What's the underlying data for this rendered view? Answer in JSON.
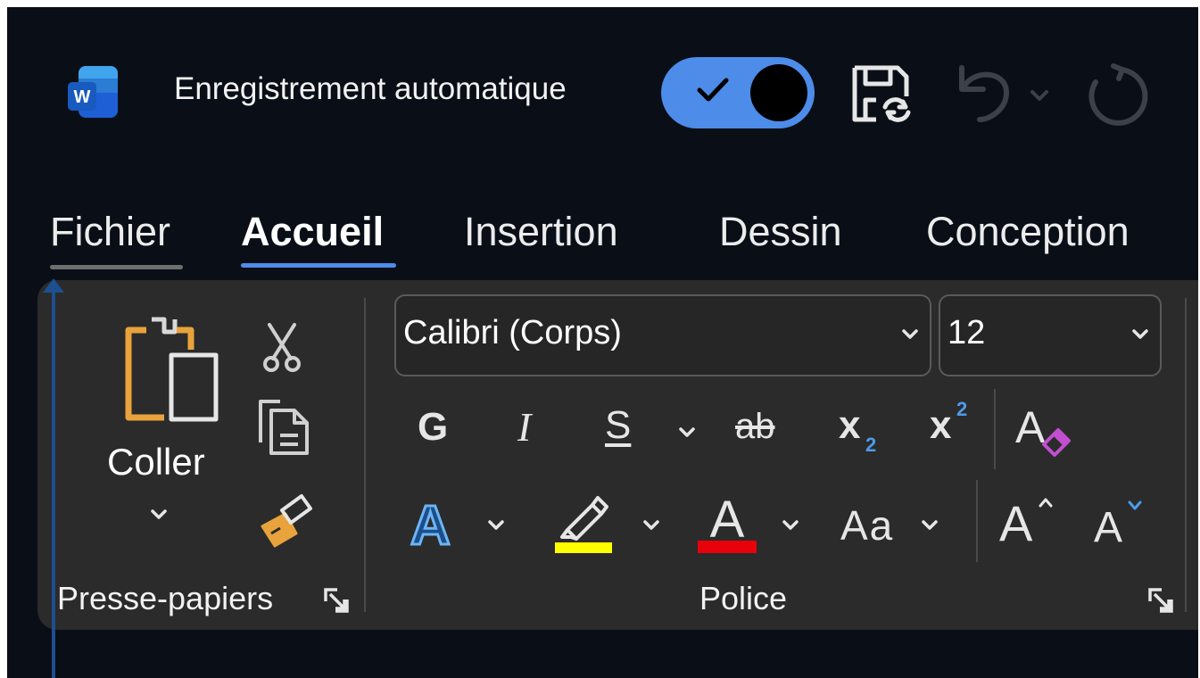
{
  "titlebar": {
    "app_icon": "word-icon",
    "app_icon_letter": "W",
    "autosave_label": "Enregistrement automatique",
    "autosave_state": "on",
    "save_icon": "save-sync-icon",
    "undo_icon": "undo-icon",
    "redo_icon": "redo-icon"
  },
  "tabs": [
    {
      "label": "Fichier",
      "active": false
    },
    {
      "label": "Accueil",
      "active": true
    },
    {
      "label": "Insertion",
      "active": false
    },
    {
      "label": "Dessin",
      "active": false
    },
    {
      "label": "Conception",
      "active": false
    }
  ],
  "clipboard": {
    "paste_label": "Coller",
    "group_label": "Presse-papiers"
  },
  "font": {
    "font_name": "Calibri (Corps)",
    "font_size": "12",
    "bold_glyph": "G",
    "italic_glyph": "I",
    "underline_glyph": "S",
    "strike_glyph": "ab",
    "subscript_base": "x",
    "subscript_index": "2",
    "superscript_base": "x",
    "superscript_index": "2",
    "change_case_glyph": "Aa",
    "grow_glyph": "A",
    "shrink_glyph": "A",
    "text_effects_glyph": "A",
    "font_color_glyph": "A",
    "group_label": "Police"
  },
  "colors": {
    "background": "#0a0e17",
    "ribbon": "#2b2b2b",
    "accent": "#4d8ce8",
    "highlight": "#ffff00",
    "font_color": "#e8000b"
  }
}
